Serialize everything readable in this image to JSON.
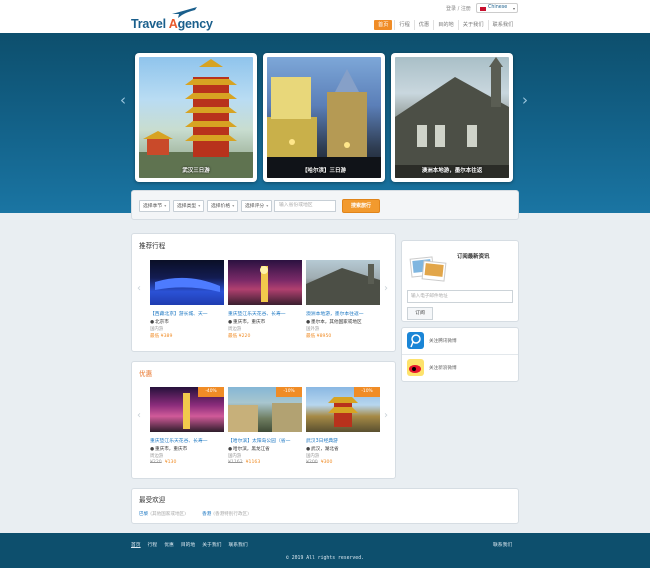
{
  "brand": {
    "logo_prefix": "Travel ",
    "logo_accent_letter": "A",
    "logo_suffix": "gency",
    "primary_color": "#1a5f8c",
    "accent_color": "#f08c26"
  },
  "header": {
    "top_links": "登录 / 注册",
    "language": "Chinese",
    "nav": [
      "首页",
      "行程",
      "优惠",
      "目的地",
      "关于我们",
      "联系我们"
    ]
  },
  "hero": {
    "slides": [
      {
        "caption": "武汉三日游"
      },
      {
        "caption": "【哈尔滨】三日游"
      },
      {
        "caption": "澳洲本地游，墨尔本往返"
      }
    ]
  },
  "search": {
    "selects": [
      "选择季节",
      "选择类型",
      "选择价格",
      "选择评分"
    ],
    "keyword_placeholder": "输入省份或地区",
    "button": "搜索旅行"
  },
  "recommended": {
    "title": "推荐行程",
    "cards": [
      {
        "title": "【西藏北京】游长城、天一",
        "loc": "北京市",
        "sub": "国内游",
        "price": "¥389",
        "prefix": "最低",
        "old": ""
      },
      {
        "title": "重庆垫江乐天花谷、长寿一",
        "loc": "重庆市，重庆市",
        "sub": "周边游",
        "price": "¥220",
        "prefix": "最低",
        "old": ""
      },
      {
        "title": "澳洲本地游，墨尔本往返一",
        "loc": "墨尔本，其他国家或地区",
        "sub": "国外游",
        "price": "¥8950",
        "prefix": "最低",
        "old": ""
      }
    ]
  },
  "deals": {
    "title": "优惠",
    "cards": [
      {
        "title": "重庆垫江乐天花谷、长寿一",
        "loc": "重庆市，重庆市",
        "sub": "周边游",
        "old": "¥220",
        "price": "¥130",
        "badge": "-40%"
      },
      {
        "title": "【哈尔滨】太阳岛公园（省一",
        "loc": "哈尔滨，黑龙江省",
        "sub": "国内游",
        "old": "¥1162",
        "price": "¥1163",
        "badge": "-10%"
      },
      {
        "title": "武汉3日经典游",
        "loc": "武汉，湖北省",
        "sub": "国内游",
        "old": "¥200",
        "price": "¥300",
        "badge": "-10%"
      }
    ]
  },
  "subscribe": {
    "title": "订阅最新资讯",
    "placeholder": "输入电子邮件地址",
    "button": "订阅"
  },
  "social": [
    {
      "label": "关注腾讯微博",
      "icon": "tencent-weibo-icon",
      "color": "#1a85d6"
    },
    {
      "label": "关注新浪微博",
      "icon": "sina-weibo-icon",
      "color": "#e6162d"
    }
  ],
  "popular": {
    "title": "最受欢迎",
    "items": [
      {
        "name": "巴黎",
        "desc": "(其他国家或地区)"
      },
      {
        "name": "香港",
        "desc": "(香港特别行政区)"
      }
    ]
  },
  "footer": {
    "links": [
      "首页",
      "行程",
      "优惠",
      "目的地",
      "关于我们",
      "联系我们"
    ],
    "contact": "联系我们",
    "copyright": "© 2019 All rights reserved."
  }
}
